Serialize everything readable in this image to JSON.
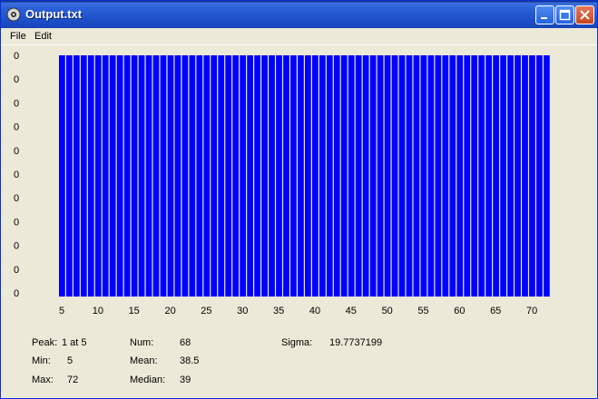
{
  "window": {
    "title": "Output.txt"
  },
  "menu": {
    "items": [
      "File",
      "Edit"
    ]
  },
  "chart_data": {
    "type": "bar",
    "x": [
      5,
      6,
      7,
      8,
      9,
      10,
      11,
      12,
      13,
      14,
      15,
      16,
      17,
      18,
      19,
      20,
      21,
      22,
      23,
      24,
      25,
      26,
      27,
      28,
      29,
      30,
      31,
      32,
      33,
      34,
      35,
      36,
      37,
      38,
      39,
      40,
      41,
      42,
      43,
      44,
      45,
      46,
      47,
      48,
      49,
      50,
      51,
      52,
      53,
      54,
      55,
      56,
      57,
      58,
      59,
      60,
      61,
      62,
      63,
      64,
      65,
      66,
      67,
      68,
      69,
      70,
      71,
      72
    ],
    "values": [
      1,
      1,
      1,
      1,
      1,
      1,
      1,
      1,
      1,
      1,
      1,
      1,
      1,
      1,
      1,
      1,
      1,
      1,
      1,
      1,
      1,
      1,
      1,
      1,
      1,
      1,
      1,
      1,
      1,
      1,
      1,
      1,
      1,
      1,
      1,
      1,
      1,
      1,
      1,
      1,
      1,
      1,
      1,
      1,
      1,
      1,
      1,
      1,
      1,
      1,
      1,
      1,
      1,
      1,
      1,
      1,
      1,
      1,
      1,
      1,
      1,
      1,
      1,
      1,
      1,
      1,
      1,
      1
    ],
    "x_ticks": [
      "5",
      "10",
      "15",
      "20",
      "25",
      "30",
      "35",
      "40",
      "45",
      "50",
      "55",
      "60",
      "65",
      "70"
    ],
    "y_ticks": [
      "0",
      "0",
      "0",
      "0",
      "0",
      "0",
      "0",
      "0",
      "0",
      "0",
      "0"
    ],
    "xlim": [
      5,
      72
    ],
    "ylim": [
      0,
      1
    ],
    "bar_color": "#0000ff"
  },
  "stats": {
    "peak_label": "Peak:",
    "peak_value": "1 at 5",
    "min_label": "Min:",
    "min_value": "5",
    "max_label": "Max:",
    "max_value": "72",
    "num_label": "Num:",
    "num_value": "68",
    "mean_label": "Mean:",
    "mean_value": "38.5",
    "median_label": "Median:",
    "median_value": "39",
    "sigma_label": "Sigma:",
    "sigma_value": "19.7737199"
  },
  "colors": {
    "titlebar": "#2a5fd8",
    "background": "#ece9d8",
    "bars": "#0000ff"
  },
  "icons": {
    "app": "gear-app-icon",
    "minimize": "minimize-icon",
    "maximize": "maximize-icon",
    "close": "close-icon"
  }
}
